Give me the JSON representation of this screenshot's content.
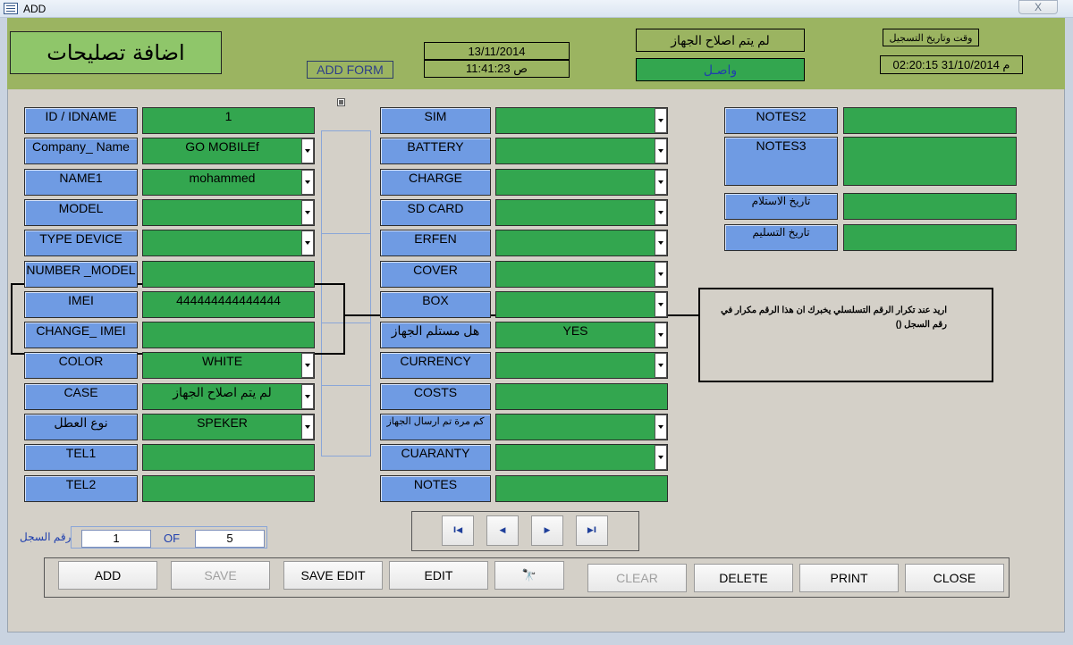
{
  "window": {
    "title": "ADD",
    "close_label": "X"
  },
  "header": {
    "form_title": "اضافة تصليحات",
    "form_tag": "ADD FORM",
    "date": "13/11/2014",
    "time": "11:41:23 ص",
    "repair_status": "لم يتم اصلاح الجهاز",
    "arrival_status": "واصـل",
    "reg_label": "وقت وتاريخ التسجيل",
    "reg_value": "02:20:15 31/10/2014 م"
  },
  "left_fields": [
    {
      "label": "ID / IDNAME",
      "value": "1",
      "dropdown": false
    },
    {
      "label": "Company_ Name",
      "value": "GO MOBILEf",
      "dropdown": true
    },
    {
      "label": "NAME1",
      "value": "mohammed",
      "dropdown": true
    },
    {
      "label": "MODEL",
      "value": "",
      "dropdown": true
    },
    {
      "label": "TYPE DEVICE",
      "value": "",
      "dropdown": true
    },
    {
      "label": "NUMBER _MODEL",
      "value": "",
      "dropdown": false
    },
    {
      "label": "IMEI",
      "value": "444444444444444",
      "dropdown": false
    },
    {
      "label": "CHANGE_ IMEI",
      "value": "",
      "dropdown": false
    },
    {
      "label": "COLOR",
      "value": "WHITE",
      "dropdown": true
    },
    {
      "label": "CASE",
      "value": "لم يتم اصلاح الجهاز",
      "dropdown": true
    },
    {
      "label": "نوع العطل",
      "value": "SPEKER",
      "dropdown": true
    },
    {
      "label": "TEL1",
      "value": "",
      "dropdown": false
    },
    {
      "label": "TEL2",
      "value": "",
      "dropdown": false
    }
  ],
  "mid_fields": [
    {
      "label": "SIM",
      "value": "",
      "dropdown": true
    },
    {
      "label": "BATTERY",
      "value": "",
      "dropdown": true
    },
    {
      "label": "CHARGE",
      "value": "",
      "dropdown": true
    },
    {
      "label": "SD CARD",
      "value": "",
      "dropdown": true
    },
    {
      "label": "ERFEN",
      "value": "",
      "dropdown": true
    },
    {
      "label": "COVER",
      "value": "",
      "dropdown": true
    },
    {
      "label": "BOX",
      "value": "",
      "dropdown": true
    },
    {
      "label": "هل مستلم الجهاز",
      "value": "YES",
      "dropdown": true
    },
    {
      "label": "CURRENCY",
      "value": "",
      "dropdown": true
    },
    {
      "label": "COSTS",
      "value": "",
      "dropdown": false
    },
    {
      "label": "كم مرة تم ارسال الجهاز",
      "value": "",
      "dropdown": true
    },
    {
      "label": "CUARANTY",
      "value": "",
      "dropdown": true
    },
    {
      "label": "NOTES",
      "value": "",
      "dropdown": false
    }
  ],
  "right_fields": [
    {
      "label": "NOTES2",
      "value": ""
    },
    {
      "label": "NOTES3",
      "value": ""
    },
    {
      "label": "تاريخ الاستلام",
      "value": ""
    },
    {
      "label": "تاريخ التسليم",
      "value": ""
    }
  ],
  "annotation": {
    "text": "اريد عند تكرار الرقم التسلسلي يخبرك ان هذا الرقم مكرار في رقم السجل ()"
  },
  "record": {
    "label": "رقم السجل",
    "current": "1",
    "of_label": "OF",
    "total": "5"
  },
  "nav_buttons": [
    {
      "name": "first-record-button",
      "glyph": "I◀"
    },
    {
      "name": "prev-record-button",
      "glyph": "◀"
    },
    {
      "name": "next-record-button",
      "glyph": "▶"
    },
    {
      "name": "last-record-button",
      "glyph": "▶I"
    }
  ],
  "buttons": {
    "add": "ADD",
    "save": "SAVE",
    "save_edit": "SAVE EDIT",
    "edit": "EDIT",
    "find_glyph": "🔭",
    "clear": "CLEAR",
    "delete": "DELETE",
    "print": "PRINT",
    "close": "CLOSE"
  }
}
